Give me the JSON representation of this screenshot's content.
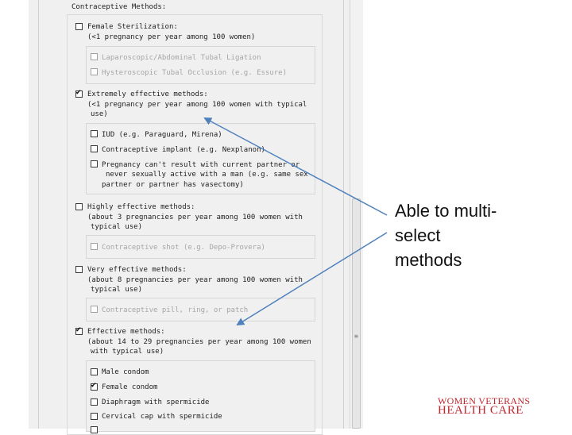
{
  "form": {
    "section_title": "Contraceptive Methods:",
    "female_sterilization": {
      "label": "Female Sterilization:",
      "sub": "(<1 pregnancy per year among 100 women)",
      "options": [
        "Laparoscopic/Abdominal Tubal Ligation",
        "Hysteroscopic Tubal Occlusion (e.g. Essure)"
      ]
    },
    "extremely_effective": {
      "label": "Extremely effective methods:",
      "sub1": "(<1 pregnancy per year among 100 women with typical",
      "sub2": "use)",
      "options": [
        "IUD (e.g. Paraguard, Mirena)",
        "Contraceptive implant (e.g. Nexplanon)",
        "Pregnancy can't result with current partner or",
        "never sexually active with a man (e.g. same sex",
        "partner or partner has vasectomy)"
      ]
    },
    "highly_effective": {
      "label": "Highly effective methods:",
      "sub1": "(about 3 pregnancies per year among 100 women with",
      "sub2": "typical use)",
      "options": [
        "Contraceptive shot (e.g. Depo-Provera)"
      ]
    },
    "very_effective": {
      "label": "Very effective methods:",
      "sub1": "(about 8 pregnancies per year among 100 women with",
      "sub2": "typical use)",
      "options": [
        "Contraceptive pill, ring, or patch"
      ]
    },
    "effective": {
      "label": "Effective methods:",
      "sub1": "(about 14 to 29 pregnancies per year among 100 women",
      "sub2": "with typical use)",
      "options": [
        "Male condom",
        "Female condom",
        "Diaphragm with spermicide",
        "Cervical cap with spermicide"
      ]
    },
    "checked_mark": "✔",
    "grip_mark": "≡"
  },
  "annotation": {
    "line1": "Able to multi-",
    "line2": "select",
    "line3": "methods",
    "arrow_color": "#4f81bd"
  },
  "branding": {
    "line1": "WOMEN VETERANS",
    "line2": "HEALTH CARE",
    "color": "#c0262e"
  }
}
